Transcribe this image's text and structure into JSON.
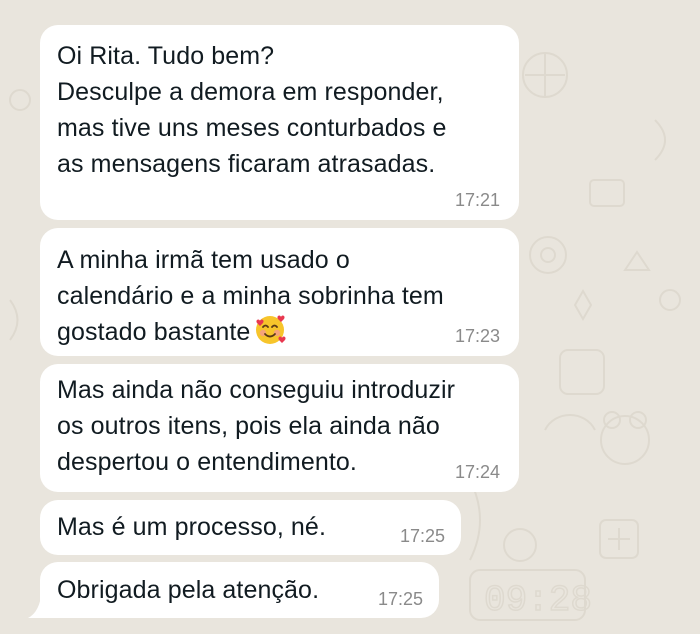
{
  "messages": [
    {
      "text": "Oi Rita. Tudo bem?\nDesculpe a demora em responder,\nmas tive uns meses conturbados e\nas mensagens ficaram atrasadas.",
      "time": "17:21"
    },
    {
      "text": "A minha irmã tem usado o\ncalendário e a minha sobrinha tem\ngostado bastante",
      "emoji": "smiling-face-with-hearts-icon",
      "time": "17:23"
    },
    {
      "text": "Mas ainda não conseguiu introduzir\nos outros itens, pois ela ainda não\ndespertou o entendimento.",
      "time": "17:24"
    },
    {
      "text": "Mas é um processo, né.",
      "time": "17:25"
    },
    {
      "text": "Obrigada pela atenção.",
      "time": "17:25"
    }
  ],
  "wallpaper_clock": "09:28",
  "colors": {
    "background": "#e9e5dd",
    "bubble": "#ffffff",
    "text": "#111b21",
    "timestamp": "#8a8a8a"
  }
}
